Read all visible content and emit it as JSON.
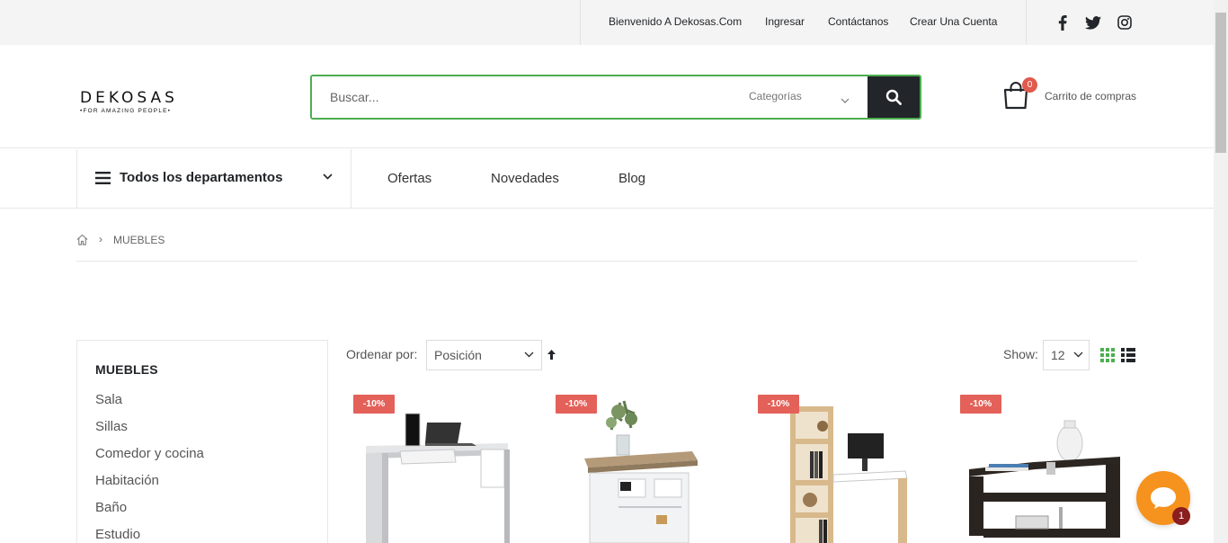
{
  "topbar": {
    "welcome": "Bienvenido A Dekosas.Com",
    "login": "Ingresar",
    "contact": "Contáctanos",
    "register": "Crear Una Cuenta"
  },
  "logo": {
    "name": "DEKOSAS",
    "tagline": "•FOR AMAZING PEOPLE•"
  },
  "search": {
    "placeholder": "Buscar...",
    "category": "Categorías"
  },
  "cart": {
    "count": "0",
    "label": "Carrito de compras"
  },
  "nav": {
    "departments": "Todos los departamentos",
    "links": [
      "Ofertas",
      "Novedades",
      "Blog"
    ]
  },
  "breadcrumb": {
    "current": "MUEBLES"
  },
  "sidebar": {
    "title": "MUEBLES",
    "items": [
      "Sala",
      "Sillas",
      "Comedor y cocina",
      "Habitación",
      "Baño",
      "Estudio"
    ]
  },
  "toolbar": {
    "sort_label": "Ordenar por:",
    "sort_value": "Posición",
    "show_label": "Show:",
    "show_value": "12"
  },
  "products": [
    {
      "discount": "-10%"
    },
    {
      "discount": "-10%"
    },
    {
      "discount": "-10%"
    },
    {
      "discount": "-10%"
    }
  ],
  "chat": {
    "count": "1"
  },
  "colors": {
    "accent": "#4caf50",
    "dark": "#222529",
    "sale": "#e36159",
    "chat": "#f6921e"
  }
}
